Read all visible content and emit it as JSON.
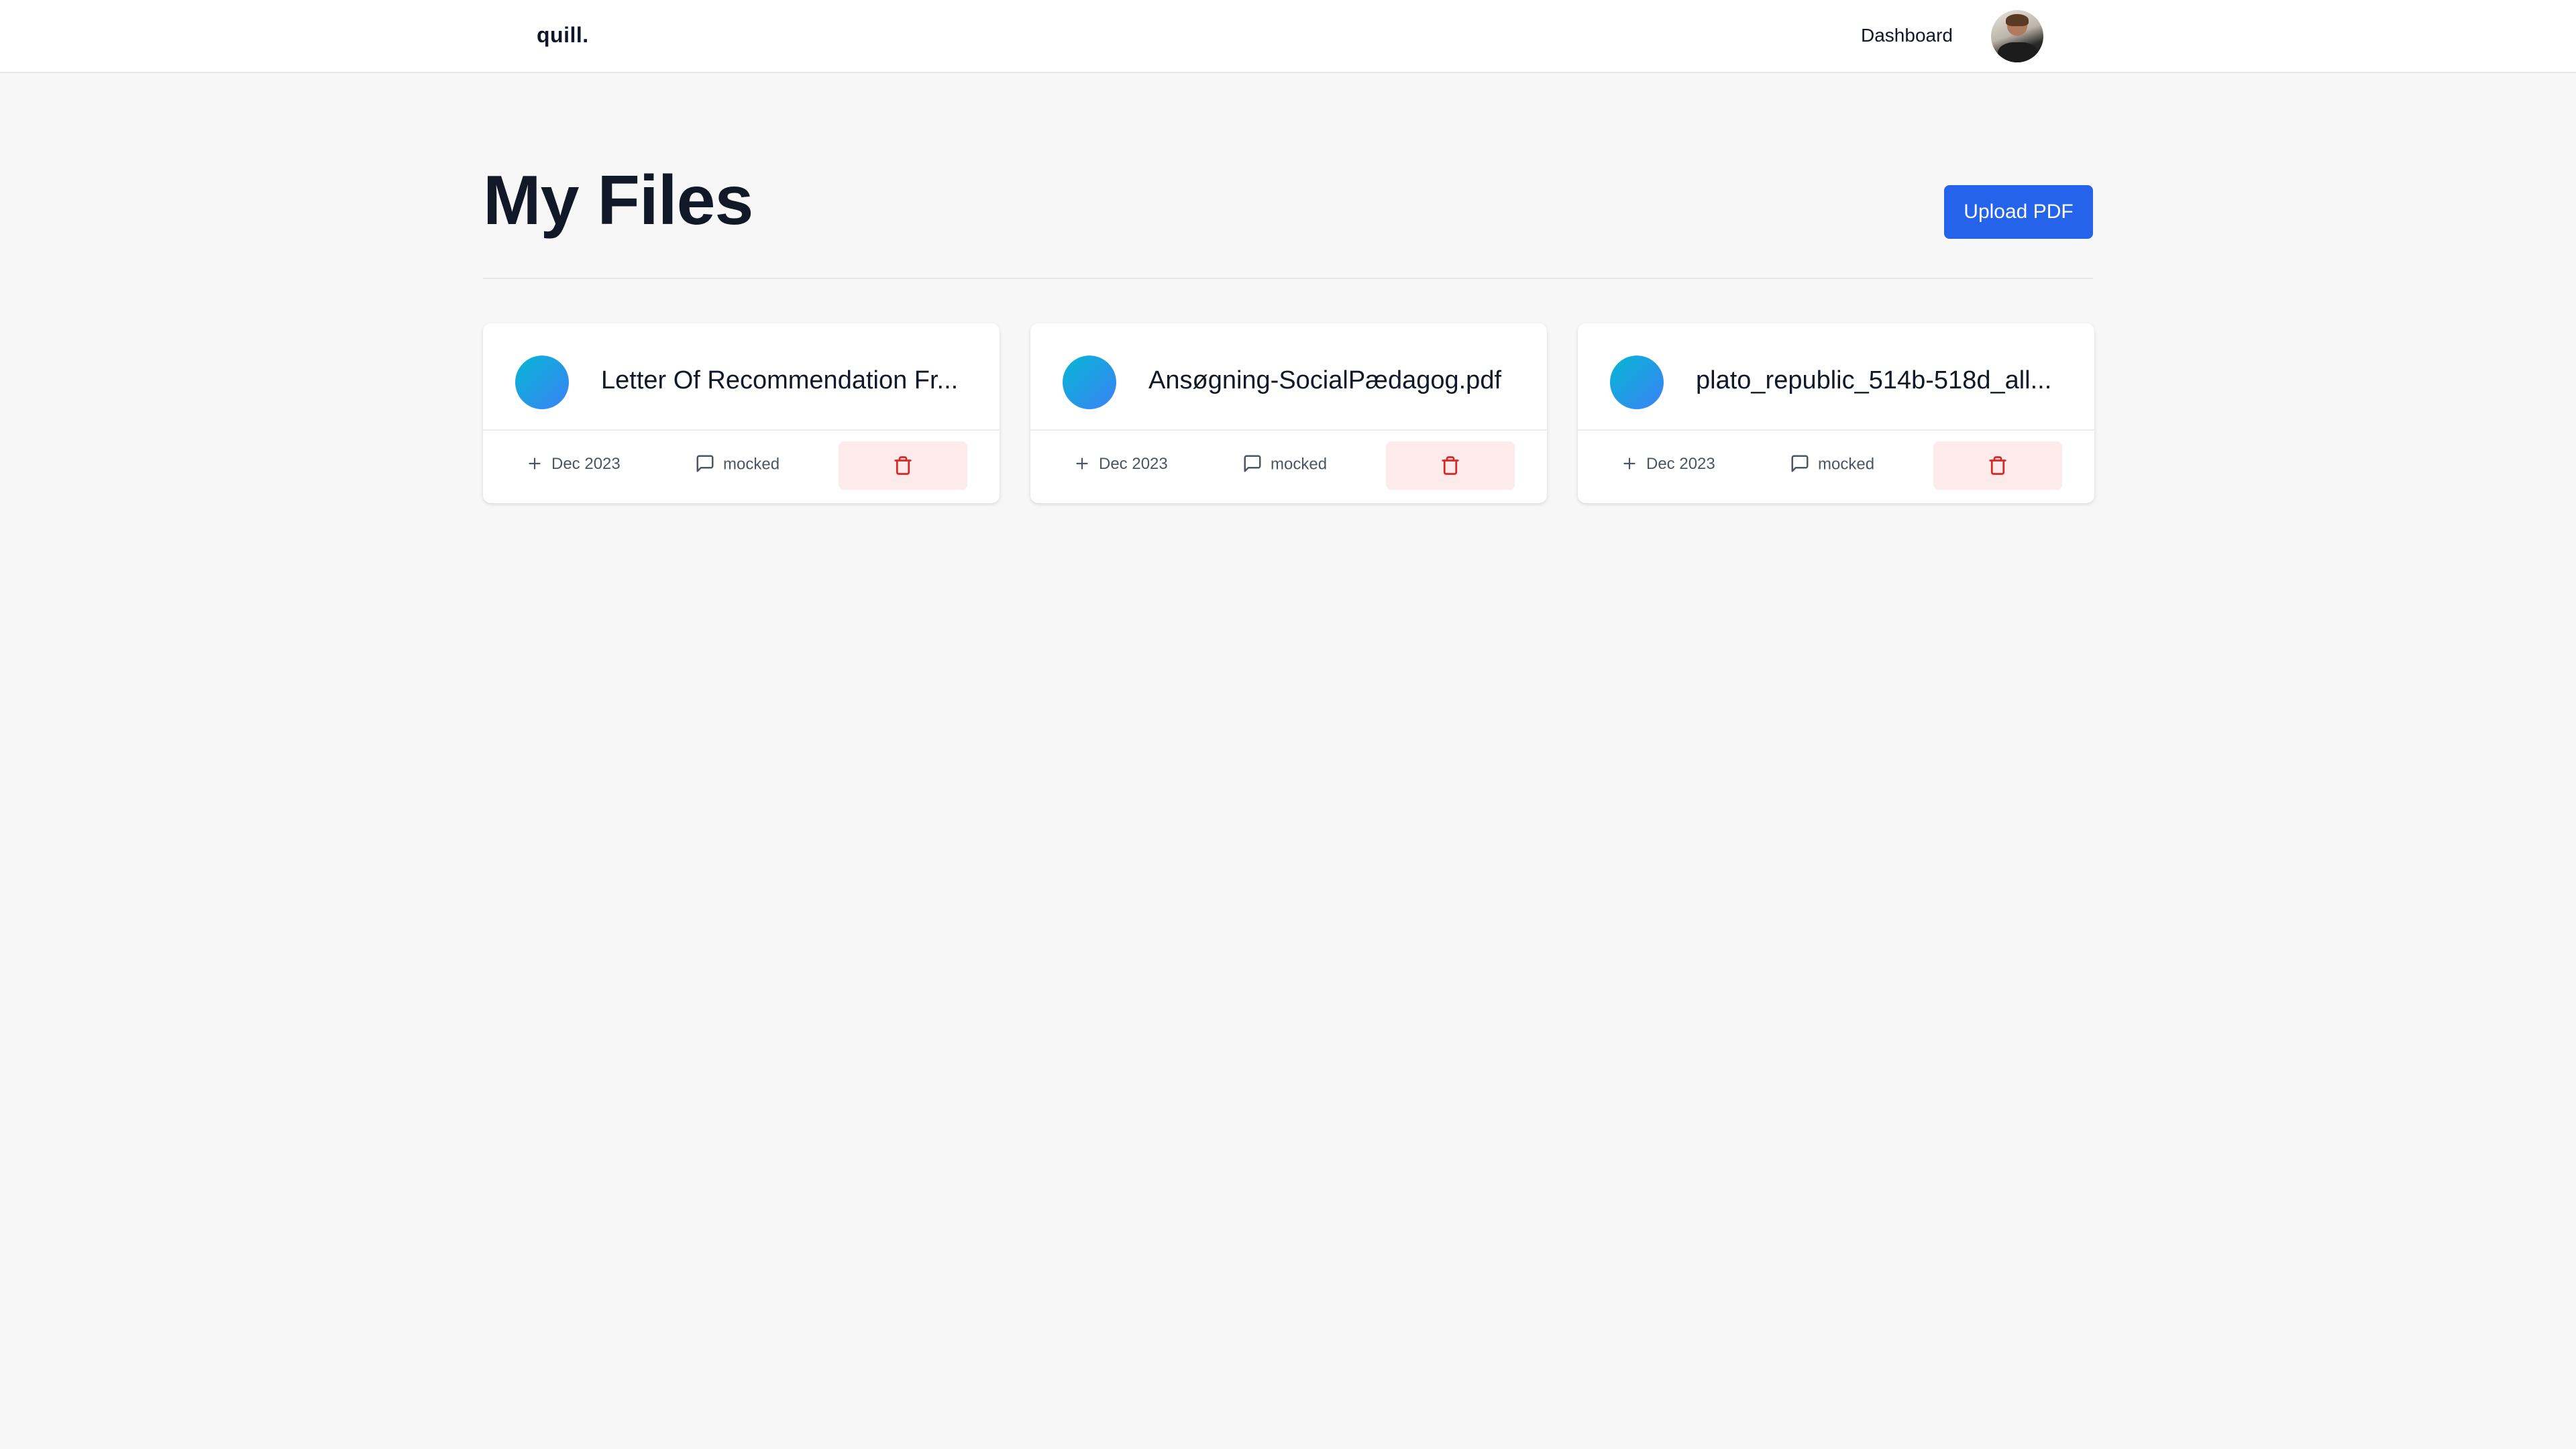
{
  "navbar": {
    "brand": "quill.",
    "dashboard_label": "Dashboard",
    "avatar_icon": "user-avatar"
  },
  "main": {
    "title": "My Files",
    "upload_label": "Upload PDF"
  },
  "files": [
    {
      "name": "Letter Of Recommendation Fr...",
      "date": "Dec 2023",
      "messages": "mocked"
    },
    {
      "name": "Ansøgning-SocialPædagog.pdf",
      "date": "Dec 2023",
      "messages": "mocked"
    },
    {
      "name": "plato_republic_514b-518d_all...",
      "date": "Dec 2023",
      "messages": "mocked"
    }
  ],
  "icons": {
    "date": "plus-icon",
    "messages": "message-square-icon",
    "delete": "trash-icon"
  },
  "colors": {
    "primary": "#2563eb",
    "delete_bg": "#fdeaea",
    "delete_icon": "#dc2626",
    "gradient_start": "#06b6d4",
    "gradient_end": "#3b82f6"
  }
}
